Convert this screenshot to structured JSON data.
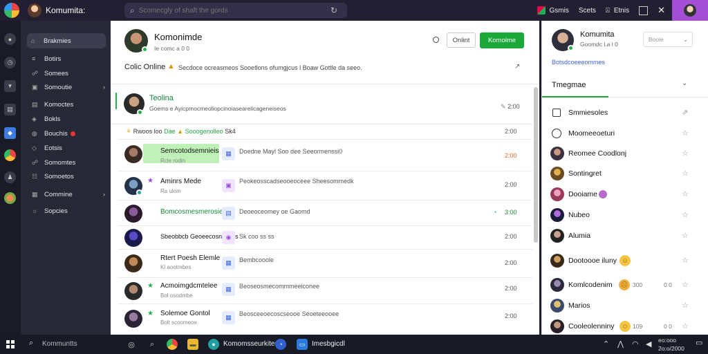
{
  "window": {
    "title": "Komumita:"
  },
  "search": {
    "placeholder": "Scomecgly of shaft the gords"
  },
  "topbar": {
    "item1": "Gsmis",
    "item2": "Scets",
    "item3": "Etnis"
  },
  "nav": {
    "items": [
      {
        "label": "Brakmies"
      },
      {
        "label": "Botirs"
      },
      {
        "label": "Somees"
      },
      {
        "label": "Somoutie"
      },
      {
        "label": "Komoctes"
      },
      {
        "label": "Bokls"
      },
      {
        "label": "Bouchis"
      },
      {
        "label": "Eotsis"
      },
      {
        "label": "Somomtes"
      },
      {
        "label": "Somoetos"
      },
      {
        "label": "Commine"
      },
      {
        "label": "Sopcies"
      }
    ]
  },
  "header": {
    "name": "Komonimde",
    "sub": "Ie comc a  0  0",
    "online_btn": "Onlint",
    "primary_btn": "Komoime",
    "status": "Colic Online",
    "desc": "Secdoce ocreasmeos  Sooetlons ofumgjcus  l  Boaw Gottle da seeo."
  },
  "pinned": {
    "title": "Teolina",
    "sub": "Goems e  Ayicpmocmeoliopcinoiasearelicageneiseos",
    "meta": "2:00"
  },
  "rowhead": {
    "text1": "Rwoos loo",
    "green1": "Dae",
    "text2": "Sooogenolleo",
    "text3": "Sk4",
    "time": "2:00"
  },
  "rows": [
    {
      "title": "Semcotodsemnieis",
      "sub": "Rcle rodin",
      "text": "Doedne Mayl Soo dee Seeormenssi0",
      "time": "2:00"
    },
    {
      "title": "Aminrs Mede",
      "sub": "Ra  ulom",
      "text": "Peokeosscadseooeoceee  Sheesommedk",
      "time": "2:00"
    },
    {
      "title": "Bomcosmesmerosiee",
      "sub": "",
      "text": "Deoeoceomey oe Gaomd",
      "time": "3:00"
    },
    {
      "title": "Sbeobbcb Geoeecosnteosls",
      "sub": "",
      "text": "Sk  coo  ss  ss",
      "time": "2:00"
    },
    {
      "title": "Rtert Poesh Elemle",
      "sub": "Kl  aootmbes",
      "text": "Bembcooole",
      "time": "2:00"
    },
    {
      "title": "Acmoimgdcmtelee",
      "sub": "Bol  osodmbe",
      "text": "Beoseosmecommmeeiconee",
      "time": "2:00"
    },
    {
      "title": "Solemoe Gontol",
      "sub": "Bolt  scoomeoe",
      "text": "Beosceeoecoscseooe  Seoeteeooee",
      "time": "2:00"
    }
  ],
  "right": {
    "name": "Komumita",
    "sub": "Goomdc  l.a  l 0",
    "select": "Boole",
    "link": "Botsdcoeeeommes",
    "tab": "Tmegmae",
    "items": [
      {
        "label": "Smmiesoles"
      },
      {
        "label": "Moomeeoeturi"
      },
      {
        "label": "Reomee Coodlonj"
      },
      {
        "label": "Sontingret"
      },
      {
        "label": "Dooiame"
      },
      {
        "label": "Nubeo"
      },
      {
        "label": "Alumia"
      },
      {
        "label": "Dootoooe iluny"
      },
      {
        "label": "Komlcodenim",
        "extra1": "300",
        "extra2": "0  0"
      },
      {
        "label": "Marios"
      },
      {
        "label": "Cooleolenniny",
        "extra1": "109",
        "extra2": "0  0"
      }
    ]
  },
  "taskbar": {
    "search": "Kommuntts",
    "app1": "Komomsseurkites",
    "app2": "Imesbgicdl",
    "clock_time": "eo:ooo",
    "clock_date": "2o:o/2000"
  }
}
